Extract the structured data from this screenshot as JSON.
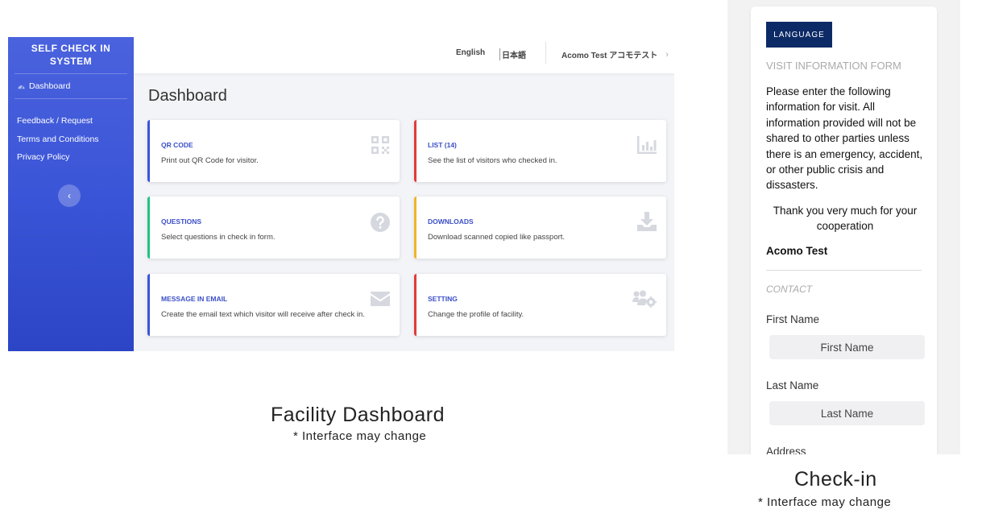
{
  "dashboard": {
    "sidebar": {
      "brand_line1": "SELF CHECK IN",
      "brand_line2": "SYSTEM",
      "dashboard_label": "Dashboard",
      "links": [
        "Feedback / Request",
        "Terms and Conditions",
        "Privacy Policy"
      ],
      "collapse_glyph": "‹"
    },
    "topbar": {
      "lang_en": "English",
      "lang_ja": "日本語",
      "user": "Acomo Test アコモテスト",
      "user_chevron": "›"
    },
    "page_title": "Dashboard",
    "cards": [
      {
        "title": "QR CODE",
        "desc": "Print out QR Code for visitor.",
        "icon": "qr-code-icon",
        "accent": "#3b55d8"
      },
      {
        "title": "LIST (14)",
        "desc": "See the list of visitors who checked in.",
        "icon": "bar-chart-icon",
        "accent": "#e03b3b"
      },
      {
        "title": "QUESTIONS",
        "desc": "Select questions in check in form.",
        "icon": "question-circle-icon",
        "accent": "#20c383"
      },
      {
        "title": "DOWNLOADS",
        "desc": "Download scanned copied like passport.",
        "icon": "download-icon",
        "accent": "#f0b429"
      },
      {
        "title": "MESSAGE IN EMAIL",
        "desc": "Create the email text which visitor will receive after check in.",
        "icon": "envelope-icon",
        "accent": "#3b55d8"
      },
      {
        "title": "SETTING",
        "desc": "Change the profile of facility.",
        "icon": "users-cog-icon",
        "accent": "#e03b3b"
      }
    ]
  },
  "captions": {
    "dashboard_title": "Facility Dashboard",
    "dashboard_note": "* Interface may change",
    "checkin_title": "Check-in",
    "checkin_note": "* Interface may change"
  },
  "checkin": {
    "language_button": "LANGUAGE",
    "form_title": "VISIT INFORMATION FORM",
    "intro": "Please enter the following information for visit. All information provided will not be shared to other parties unless there is an emergency, accident, or other public crisis and dissasters.",
    "thanks": "Thank you very much for your cooperation",
    "facility_name": "Acomo Test",
    "section_label": "CONTACT",
    "first_name_label": "First Name",
    "first_name_placeholder": "First Name",
    "last_name_label": "Last Name",
    "last_name_placeholder": "Last Name",
    "address_label": "Address"
  }
}
